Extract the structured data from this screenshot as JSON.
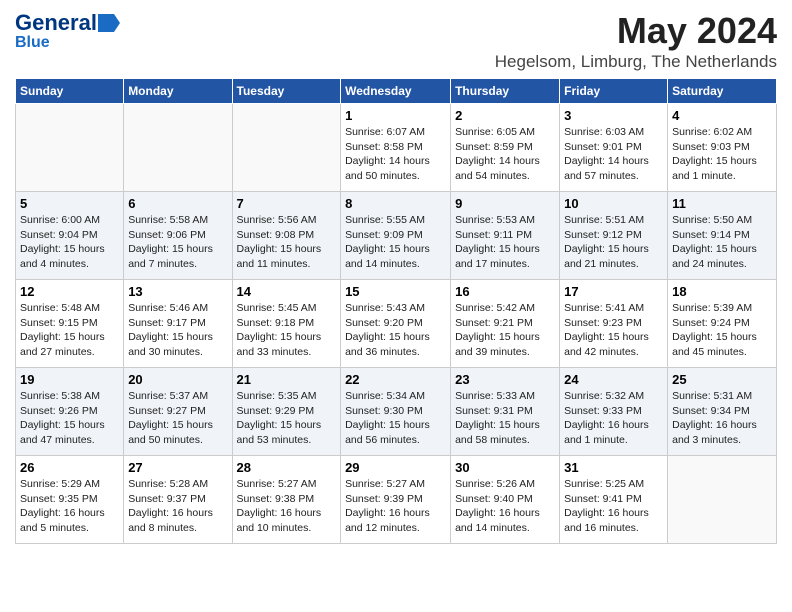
{
  "logo": {
    "general": "General",
    "blue": "Blue",
    "icon_shape": "arrow"
  },
  "title": "May 2024",
  "subtitle": "Hegelsom, Limburg, The Netherlands",
  "days_of_week": [
    "Sunday",
    "Monday",
    "Tuesday",
    "Wednesday",
    "Thursday",
    "Friday",
    "Saturday"
  ],
  "weeks": [
    [
      {
        "day": null,
        "info": null
      },
      {
        "day": null,
        "info": null
      },
      {
        "day": null,
        "info": null
      },
      {
        "day": "1",
        "info": "Sunrise: 6:07 AM\nSunset: 8:58 PM\nDaylight: 14 hours\nand 50 minutes."
      },
      {
        "day": "2",
        "info": "Sunrise: 6:05 AM\nSunset: 8:59 PM\nDaylight: 14 hours\nand 54 minutes."
      },
      {
        "day": "3",
        "info": "Sunrise: 6:03 AM\nSunset: 9:01 PM\nDaylight: 14 hours\nand 57 minutes."
      },
      {
        "day": "4",
        "info": "Sunrise: 6:02 AM\nSunset: 9:03 PM\nDaylight: 15 hours\nand 1 minute."
      }
    ],
    [
      {
        "day": "5",
        "info": "Sunrise: 6:00 AM\nSunset: 9:04 PM\nDaylight: 15 hours\nand 4 minutes."
      },
      {
        "day": "6",
        "info": "Sunrise: 5:58 AM\nSunset: 9:06 PM\nDaylight: 15 hours\nand 7 minutes."
      },
      {
        "day": "7",
        "info": "Sunrise: 5:56 AM\nSunset: 9:08 PM\nDaylight: 15 hours\nand 11 minutes."
      },
      {
        "day": "8",
        "info": "Sunrise: 5:55 AM\nSunset: 9:09 PM\nDaylight: 15 hours\nand 14 minutes."
      },
      {
        "day": "9",
        "info": "Sunrise: 5:53 AM\nSunset: 9:11 PM\nDaylight: 15 hours\nand 17 minutes."
      },
      {
        "day": "10",
        "info": "Sunrise: 5:51 AM\nSunset: 9:12 PM\nDaylight: 15 hours\nand 21 minutes."
      },
      {
        "day": "11",
        "info": "Sunrise: 5:50 AM\nSunset: 9:14 PM\nDaylight: 15 hours\nand 24 minutes."
      }
    ],
    [
      {
        "day": "12",
        "info": "Sunrise: 5:48 AM\nSunset: 9:15 PM\nDaylight: 15 hours\nand 27 minutes."
      },
      {
        "day": "13",
        "info": "Sunrise: 5:46 AM\nSunset: 9:17 PM\nDaylight: 15 hours\nand 30 minutes."
      },
      {
        "day": "14",
        "info": "Sunrise: 5:45 AM\nSunset: 9:18 PM\nDaylight: 15 hours\nand 33 minutes."
      },
      {
        "day": "15",
        "info": "Sunrise: 5:43 AM\nSunset: 9:20 PM\nDaylight: 15 hours\nand 36 minutes."
      },
      {
        "day": "16",
        "info": "Sunrise: 5:42 AM\nSunset: 9:21 PM\nDaylight: 15 hours\nand 39 minutes."
      },
      {
        "day": "17",
        "info": "Sunrise: 5:41 AM\nSunset: 9:23 PM\nDaylight: 15 hours\nand 42 minutes."
      },
      {
        "day": "18",
        "info": "Sunrise: 5:39 AM\nSunset: 9:24 PM\nDaylight: 15 hours\nand 45 minutes."
      }
    ],
    [
      {
        "day": "19",
        "info": "Sunrise: 5:38 AM\nSunset: 9:26 PM\nDaylight: 15 hours\nand 47 minutes."
      },
      {
        "day": "20",
        "info": "Sunrise: 5:37 AM\nSunset: 9:27 PM\nDaylight: 15 hours\nand 50 minutes."
      },
      {
        "day": "21",
        "info": "Sunrise: 5:35 AM\nSunset: 9:29 PM\nDaylight: 15 hours\nand 53 minutes."
      },
      {
        "day": "22",
        "info": "Sunrise: 5:34 AM\nSunset: 9:30 PM\nDaylight: 15 hours\nand 56 minutes."
      },
      {
        "day": "23",
        "info": "Sunrise: 5:33 AM\nSunset: 9:31 PM\nDaylight: 15 hours\nand 58 minutes."
      },
      {
        "day": "24",
        "info": "Sunrise: 5:32 AM\nSunset: 9:33 PM\nDaylight: 16 hours\nand 1 minute."
      },
      {
        "day": "25",
        "info": "Sunrise: 5:31 AM\nSunset: 9:34 PM\nDaylight: 16 hours\nand 3 minutes."
      }
    ],
    [
      {
        "day": "26",
        "info": "Sunrise: 5:29 AM\nSunset: 9:35 PM\nDaylight: 16 hours\nand 5 minutes."
      },
      {
        "day": "27",
        "info": "Sunrise: 5:28 AM\nSunset: 9:37 PM\nDaylight: 16 hours\nand 8 minutes."
      },
      {
        "day": "28",
        "info": "Sunrise: 5:27 AM\nSunset: 9:38 PM\nDaylight: 16 hours\nand 10 minutes."
      },
      {
        "day": "29",
        "info": "Sunrise: 5:27 AM\nSunset: 9:39 PM\nDaylight: 16 hours\nand 12 minutes."
      },
      {
        "day": "30",
        "info": "Sunrise: 5:26 AM\nSunset: 9:40 PM\nDaylight: 16 hours\nand 14 minutes."
      },
      {
        "day": "31",
        "info": "Sunrise: 5:25 AM\nSunset: 9:41 PM\nDaylight: 16 hours\nand 16 minutes."
      },
      {
        "day": null,
        "info": null
      }
    ]
  ]
}
